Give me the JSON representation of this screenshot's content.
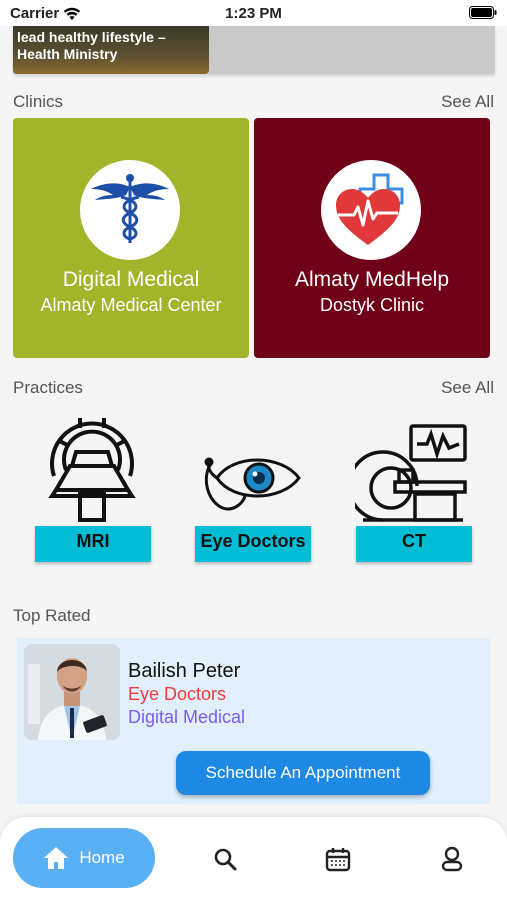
{
  "status_bar": {
    "carrier": "Carrier",
    "time": "1:23 PM"
  },
  "banner": {
    "text": "lead healthy lifestyle – Health Ministry"
  },
  "clinics": {
    "title": "Clinics",
    "see_all": "See All",
    "items": [
      {
        "name": "Digital Medical",
        "subtitle": "Almaty Medical Center",
        "color": "#a2b42a",
        "icon": "caduceus-icon"
      },
      {
        "name": "Almaty MedHelp",
        "subtitle": "Dostyk Clinic",
        "color": "#700018",
        "icon": "heart-pulse-icon"
      }
    ]
  },
  "practices": {
    "title": "Practices",
    "see_all": "See All",
    "items": [
      {
        "label": "MRI",
        "icon": "mri-scanner-icon"
      },
      {
        "label": "Eye Doctors",
        "icon": "eye-stethoscope-icon"
      },
      {
        "label": "CT",
        "icon": "ct-scanner-icon"
      }
    ]
  },
  "top_rated": {
    "title": "Top Rated",
    "doctor": {
      "name": "Bailish Peter",
      "specialty": "Eye Doctors",
      "clinic": "Digital Medical",
      "button": "Schedule An Appointment"
    }
  },
  "bottom_nav": {
    "home_label": "Home",
    "items": [
      "home-icon",
      "search-icon",
      "calendar-icon",
      "profile-icon"
    ],
    "active_color": "#5ab0f5"
  }
}
